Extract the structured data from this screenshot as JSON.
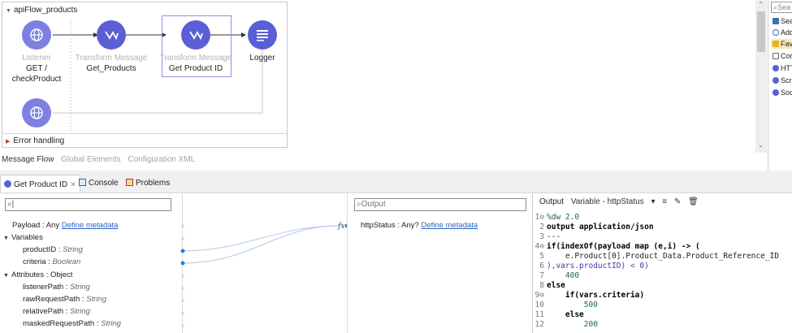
{
  "flow": {
    "title": "apiFlow_products",
    "nodes": [
      {
        "type": "Listener",
        "name": "GET /\ncheckProduct"
      },
      {
        "type": "Transform Message",
        "name": "Get_Products"
      },
      {
        "type": "Transform Message",
        "name": "Get Product ID"
      },
      {
        "type": "",
        "name": "Logger"
      }
    ],
    "error_handling": "Error handling",
    "tabs": [
      "Message Flow",
      "Global Elements",
      "Configuration XML"
    ]
  },
  "palette": {
    "search_placeholder": "Sea",
    "items": [
      "Sea",
      "Add",
      "Fav",
      "Cor",
      "HTT",
      "Scri",
      "Soc"
    ]
  },
  "bottom_tabs": [
    {
      "label": "Get Product ID",
      "active": true
    },
    {
      "label": "Console",
      "active": false
    },
    {
      "label": "Problems",
      "active": false
    }
  ],
  "input": {
    "search_value": "",
    "payload": {
      "label": "Payload : Any",
      "link": "Define metadata"
    },
    "variables_label": "Variables",
    "variables": [
      {
        "name": "productID",
        "type": "String"
      },
      {
        "name": "criteria",
        "type": "Boolean"
      }
    ],
    "attributes_label": "Attributes : Object",
    "attributes": [
      {
        "name": "listenerPath",
        "type": "String"
      },
      {
        "name": "rawRequestPath",
        "type": "String"
      },
      {
        "name": "relativePath",
        "type": "String"
      },
      {
        "name": "maskedRequestPath",
        "type": "String"
      }
    ]
  },
  "output": {
    "search_placeholder": "Output",
    "field": {
      "label": "httpStatus : Any?",
      "link": "Define metadata"
    }
  },
  "code": {
    "header_label": "Output",
    "header_target": "Variable - httpStatus",
    "lines": [
      "%dw 2.0",
      "output application/json",
      "---",
      "if(indexOf(payload map (e,i) -> (",
      "    e.Product[0].Product_Data.Product_Reference_ID",
      "),vars.productID) < 0)",
      "    400",
      "else",
      "    if(vars.criteria)",
      "        500",
      "    else",
      "        200"
    ]
  }
}
